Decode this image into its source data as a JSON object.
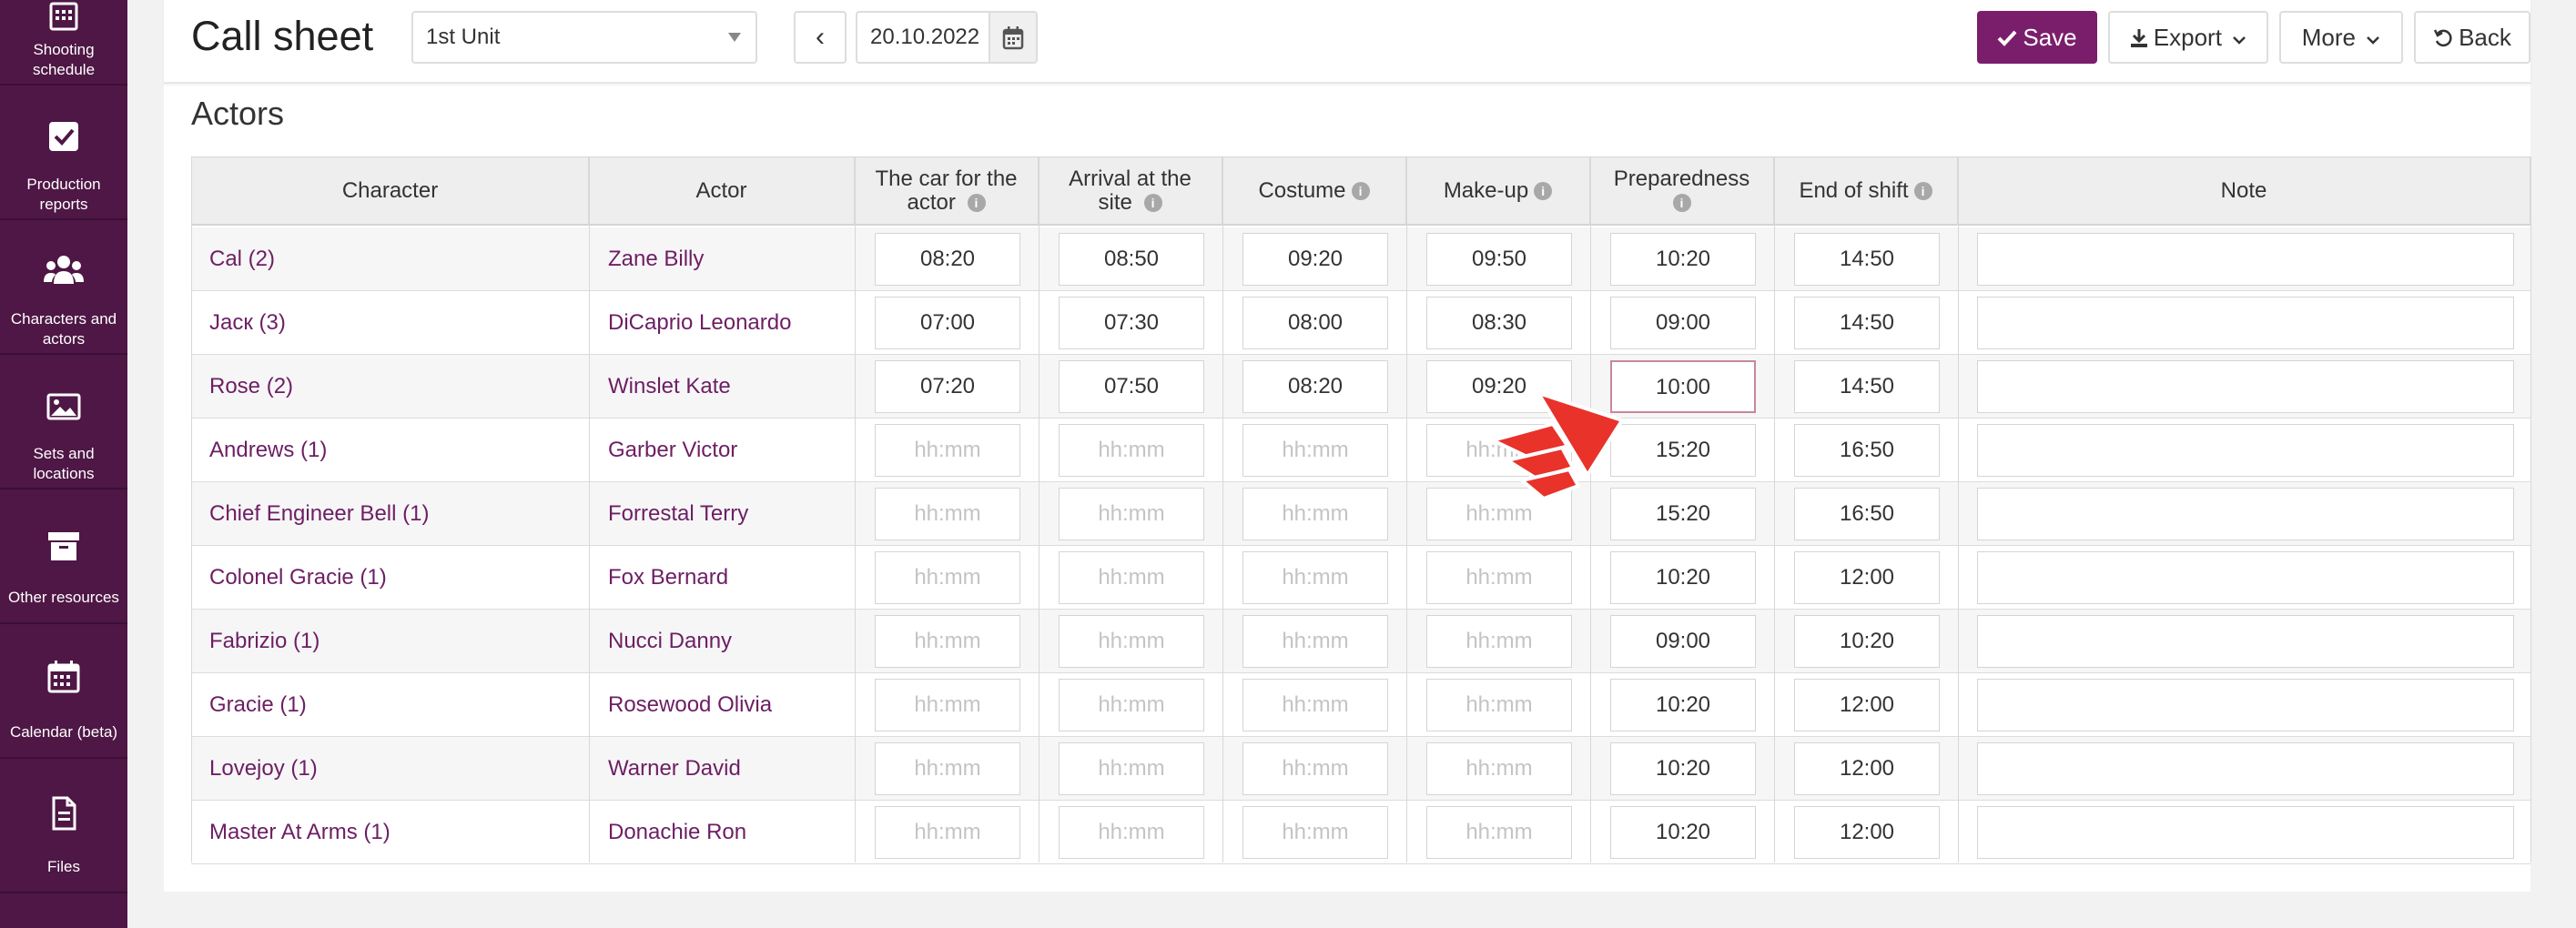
{
  "sidebar": {
    "items": [
      {
        "label_line1": "Shooting",
        "label_line2": "schedule",
        "icon": "grid-calendar-icon"
      },
      {
        "label_line1": "Production",
        "label_line2": "reports",
        "icon": "checkbox-icon"
      },
      {
        "label_line1": "Characters and",
        "label_line2": "actors",
        "icon": "people-icon"
      },
      {
        "label_line1": "Sets and",
        "label_line2": "locations",
        "icon": "image-icon"
      },
      {
        "label_line1": "Other resources",
        "label_line2": "",
        "icon": "archive-icon"
      },
      {
        "label_line1": "Calendar (beta)",
        "label_line2": "",
        "icon": "calendar-icon"
      },
      {
        "label_line1": "Files",
        "label_line2": "",
        "icon": "file-icon"
      }
    ]
  },
  "header": {
    "title": "Call sheet",
    "unit_select": "1st Unit",
    "prev_label": "‹",
    "date": "20.10.2022",
    "save_label": "Save",
    "export_label": "Export",
    "more_label": "More",
    "back_label": "Back"
  },
  "section": {
    "title": "Actors"
  },
  "table": {
    "columns": {
      "character": "Character",
      "actor": "Actor",
      "car_line1": "The car for the",
      "car_line2": "actor",
      "arrival_line1": "Arrival at the",
      "arrival_line2": "site",
      "costume": "Costume",
      "makeup": "Make-up",
      "preparedness": "Preparedness",
      "end_of_shift": "End of shift",
      "note": "Note"
    },
    "placeholder": "hh:mm",
    "rows": [
      {
        "character": "Cal (2)",
        "actor": "Zane Billy",
        "car": "08:20",
        "arrival": "08:50",
        "costume": "09:20",
        "makeup": "09:50",
        "prep": "10:20",
        "end": "14:50",
        "note": ""
      },
      {
        "character": "Jacк (3)",
        "actor": "DiCaprio Leonardo",
        "car": "07:00",
        "arrival": "07:30",
        "costume": "08:00",
        "makeup": "08:30",
        "prep": "09:00",
        "end": "14:50",
        "note": ""
      },
      {
        "character": "Rose (2)",
        "actor": "Winslet Kate",
        "car": "07:20",
        "arrival": "07:50",
        "costume": "08:20",
        "makeup": "09:20",
        "prep": "10:00",
        "end": "14:50",
        "note": ""
      },
      {
        "character": "Andrews (1)",
        "actor": "Garber Victor",
        "car": "",
        "arrival": "",
        "costume": "",
        "makeup": "",
        "prep": "15:20",
        "end": "16:50",
        "note": ""
      },
      {
        "character": "Chief Engineer Bell (1)",
        "actor": "Forrestal Terry",
        "car": "",
        "arrival": "",
        "costume": "",
        "makeup": "",
        "prep": "15:20",
        "end": "16:50",
        "note": ""
      },
      {
        "character": "Colonel Gracie (1)",
        "actor": "Fox Bernard",
        "car": "",
        "arrival": "",
        "costume": "",
        "makeup": "",
        "prep": "10:20",
        "end": "12:00",
        "note": ""
      },
      {
        "character": "Fabrizio (1)",
        "actor": "Nucci Danny",
        "car": "",
        "arrival": "",
        "costume": "",
        "makeup": "",
        "prep": "09:00",
        "end": "10:20",
        "note": ""
      },
      {
        "character": "Gracie (1)",
        "actor": "Rosewood Olivia",
        "car": "",
        "arrival": "",
        "costume": "",
        "makeup": "",
        "prep": "10:20",
        "end": "12:00",
        "note": ""
      },
      {
        "character": "Lovejoy (1)",
        "actor": "Warner David",
        "car": "",
        "arrival": "",
        "costume": "",
        "makeup": "",
        "prep": "10:20",
        "end": "12:00",
        "note": ""
      },
      {
        "character": "Master At Arms (1)",
        "actor": "Donachie Ron",
        "car": "",
        "arrival": "",
        "costume": "",
        "makeup": "",
        "prep": "10:20",
        "end": "12:00",
        "note": ""
      }
    ]
  },
  "colors": {
    "brand": "#4e1745",
    "accent": "#7a1e6c",
    "link": "#6d1e64",
    "cursor": "#e8322a"
  }
}
